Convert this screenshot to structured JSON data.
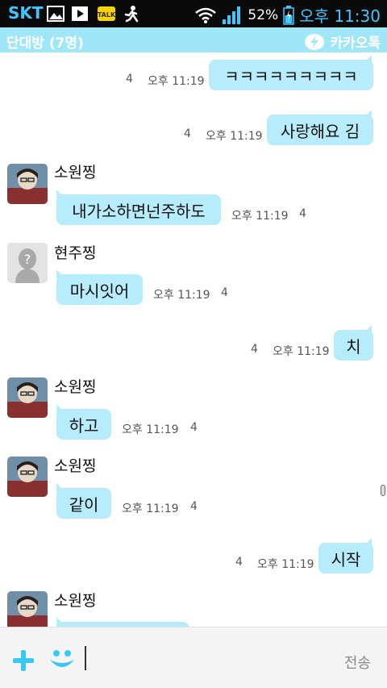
{
  "status_bar": {
    "carrier": "SKT",
    "battery": "52%",
    "time": "오후 11:30",
    "icons": [
      "image-icon",
      "play-icon",
      "kakaotalk-icon",
      "runner-icon",
      "wifi-icon",
      "signal-icon",
      "battery-icon"
    ],
    "accent": "#3fc6ff"
  },
  "title_bar": {
    "title": "단대방 (7명)",
    "brand": "카카오톡",
    "color": "#9fe6f9"
  },
  "messages": [
    {
      "type": "sent",
      "text": "ㅋㅋㅋㅋㅋㅋㅋㅋㅋ",
      "time": "오후 11:19",
      "unread": "4"
    },
    {
      "type": "sent",
      "text": "사랑해요 김",
      "time": "오후 11:19",
      "unread": "4"
    },
    {
      "type": "received",
      "sender": "소원찡",
      "text": "내가소하면넌주하도",
      "time": "오후 11:19",
      "unread": "4"
    },
    {
      "type": "received",
      "sender": "현주찡",
      "text": "마시잇어",
      "time": "오후 11:19",
      "unread": "4"
    },
    {
      "type": "sent",
      "text": "치",
      "time": "오후 11:19",
      "unread": "4"
    },
    {
      "type": "received",
      "sender": "소원찡",
      "text": "하고",
      "time": "오후 11:19",
      "unread": "4"
    },
    {
      "type": "received",
      "sender": "소원찡",
      "text": "같이",
      "time": "오후 11:19",
      "unread": "4"
    },
    {
      "type": "sent",
      "text": "시작",
      "time": "오후 11:19",
      "unread": "4"
    },
    {
      "type": "received",
      "sender": "소원찡",
      "text": "",
      "time": "",
      "unread": ""
    }
  ],
  "input_bar": {
    "send_label": "전송",
    "input_value": ""
  },
  "colors": {
    "bubble": "#b6ecfb",
    "icon_blue": "#38c9f2"
  }
}
